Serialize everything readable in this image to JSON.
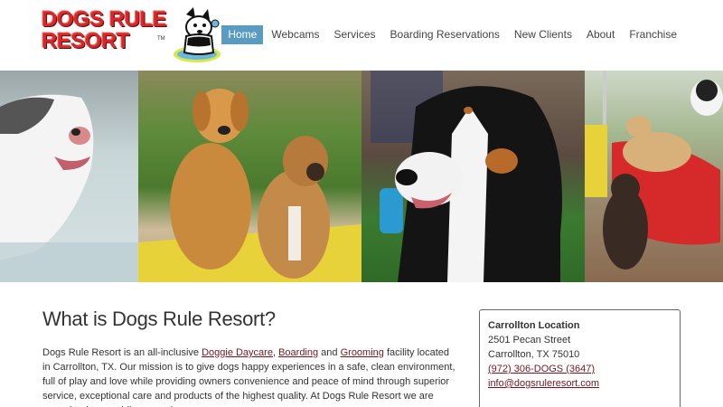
{
  "brand": {
    "logo_line1": "DOGS RULE",
    "logo_line2": "RESORT",
    "logo_tm": "TM"
  },
  "nav": {
    "items": [
      {
        "label": "Home",
        "active": true
      },
      {
        "label": "Webcams",
        "active": false
      },
      {
        "label": "Services",
        "active": false
      },
      {
        "label": "Boarding Reservations",
        "active": false
      },
      {
        "label": "New Clients",
        "active": false
      },
      {
        "label": "About",
        "active": false
      },
      {
        "label": "Franchise",
        "active": false
      }
    ]
  },
  "main": {
    "heading": "What is Dogs Rule Resort?",
    "intro": {
      "t1": "Dogs Rule Resort is an all-inclusive ",
      "link_daycare": "Doggie Daycare",
      "t2": ", ",
      "link_boarding": "Boarding",
      "t3": " and ",
      "link_grooming": "Grooming",
      "t4": " facility located in Carrollton, TX. Our mission is to give dogs happy experiences in a safe, clean environment, full of play and love while providing owners convenience and peace of mind through superior service, exceptional care and products of the highest quality. At Dogs Rule Resort we are committed to providing your dog"
    }
  },
  "location": {
    "title": "Carrollton Location",
    "street": "2501 Pecan Street",
    "city": "Carrollton, TX 75010",
    "phone": "(972) 306-DOGS (3647)",
    "email": "info@dogsruleresort.com"
  },
  "colors": {
    "nav_active": "#5a9bc4",
    "link": "#7a1520",
    "logo_red": "#d8262a"
  }
}
